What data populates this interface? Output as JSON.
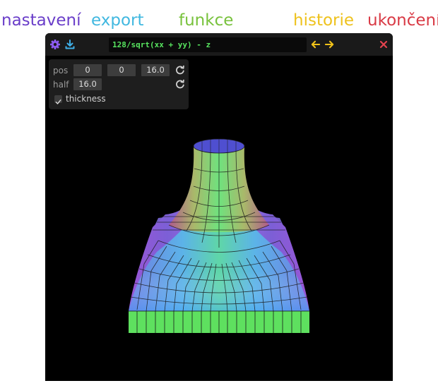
{
  "menu": {
    "settings": "nastavení",
    "export": "export",
    "functions": "funkce",
    "history": "historie",
    "quit": "ukončení"
  },
  "colors": {
    "settings": "#6a3ec9",
    "export": "#41b8e0",
    "functions": "#78c23c",
    "history": "#eec21d",
    "quit": "#d93a45",
    "close": "#e5434f",
    "arrows": "#f2c319",
    "expression": "#57e35f"
  },
  "toolbar": {
    "settings_icon": "gear-icon",
    "export_icon": "download-icon",
    "back_icon": "arrow-left-icon",
    "forward_icon": "arrow-right-icon",
    "close_icon": "close-icon",
    "expression": "128/sqrt(xx + yy) - z"
  },
  "panel": {
    "pos_label": "pos",
    "pos_x": "0",
    "pos_y": "0",
    "pos_z": "16.0",
    "half_label": "half",
    "half_value": "16.0",
    "reset_icon": "reset-icon",
    "thickness_label": "thickness",
    "thickness_checked": true
  }
}
